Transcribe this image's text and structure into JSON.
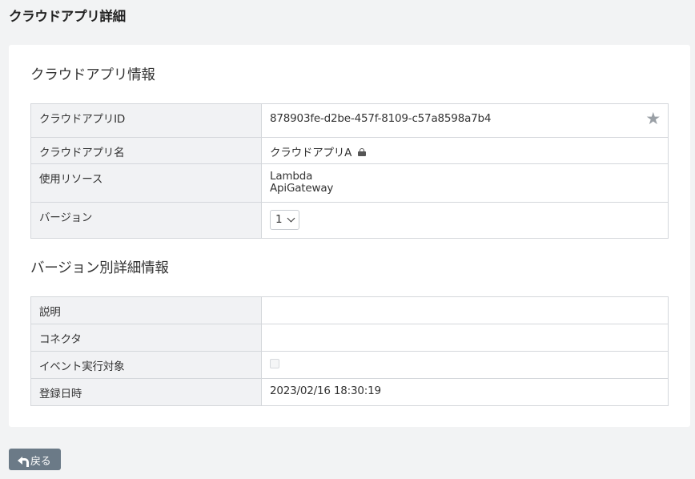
{
  "page": {
    "title": "クラウドアプリ詳細"
  },
  "app_info": {
    "section_title": "クラウドアプリ情報",
    "rows": {
      "id": {
        "label": "クラウドアプリID",
        "value": "878903fe-d2be-457f-8109-c57a8598a7b4"
      },
      "name": {
        "label": "クラウドアプリ名",
        "value": "クラウドアプリA"
      },
      "resources": {
        "label": "使用リソース",
        "values": [
          "Lambda",
          "ApiGateway"
        ]
      },
      "version": {
        "label": "バージョン",
        "selected": "1"
      }
    },
    "icons": {
      "favorite": "star-icon",
      "locked": "lock-icon"
    }
  },
  "version_info": {
    "section_title": "バージョン別詳細情報",
    "rows": {
      "description": {
        "label": "説明",
        "value": ""
      },
      "connector": {
        "label": "コネクタ",
        "value": ""
      },
      "event_target": {
        "label": "イベント実行対象",
        "checked": false
      },
      "registered": {
        "label": "登録日時",
        "value": "2023/02/16 18:30:19"
      }
    }
  },
  "footer": {
    "back_label": "戻る"
  },
  "colors": {
    "background": "#f2f3f4",
    "label_cell": "#f1f2f4",
    "border": "#d4d7db",
    "back_button": "#6b7a87",
    "star": "#9aa0a6"
  }
}
